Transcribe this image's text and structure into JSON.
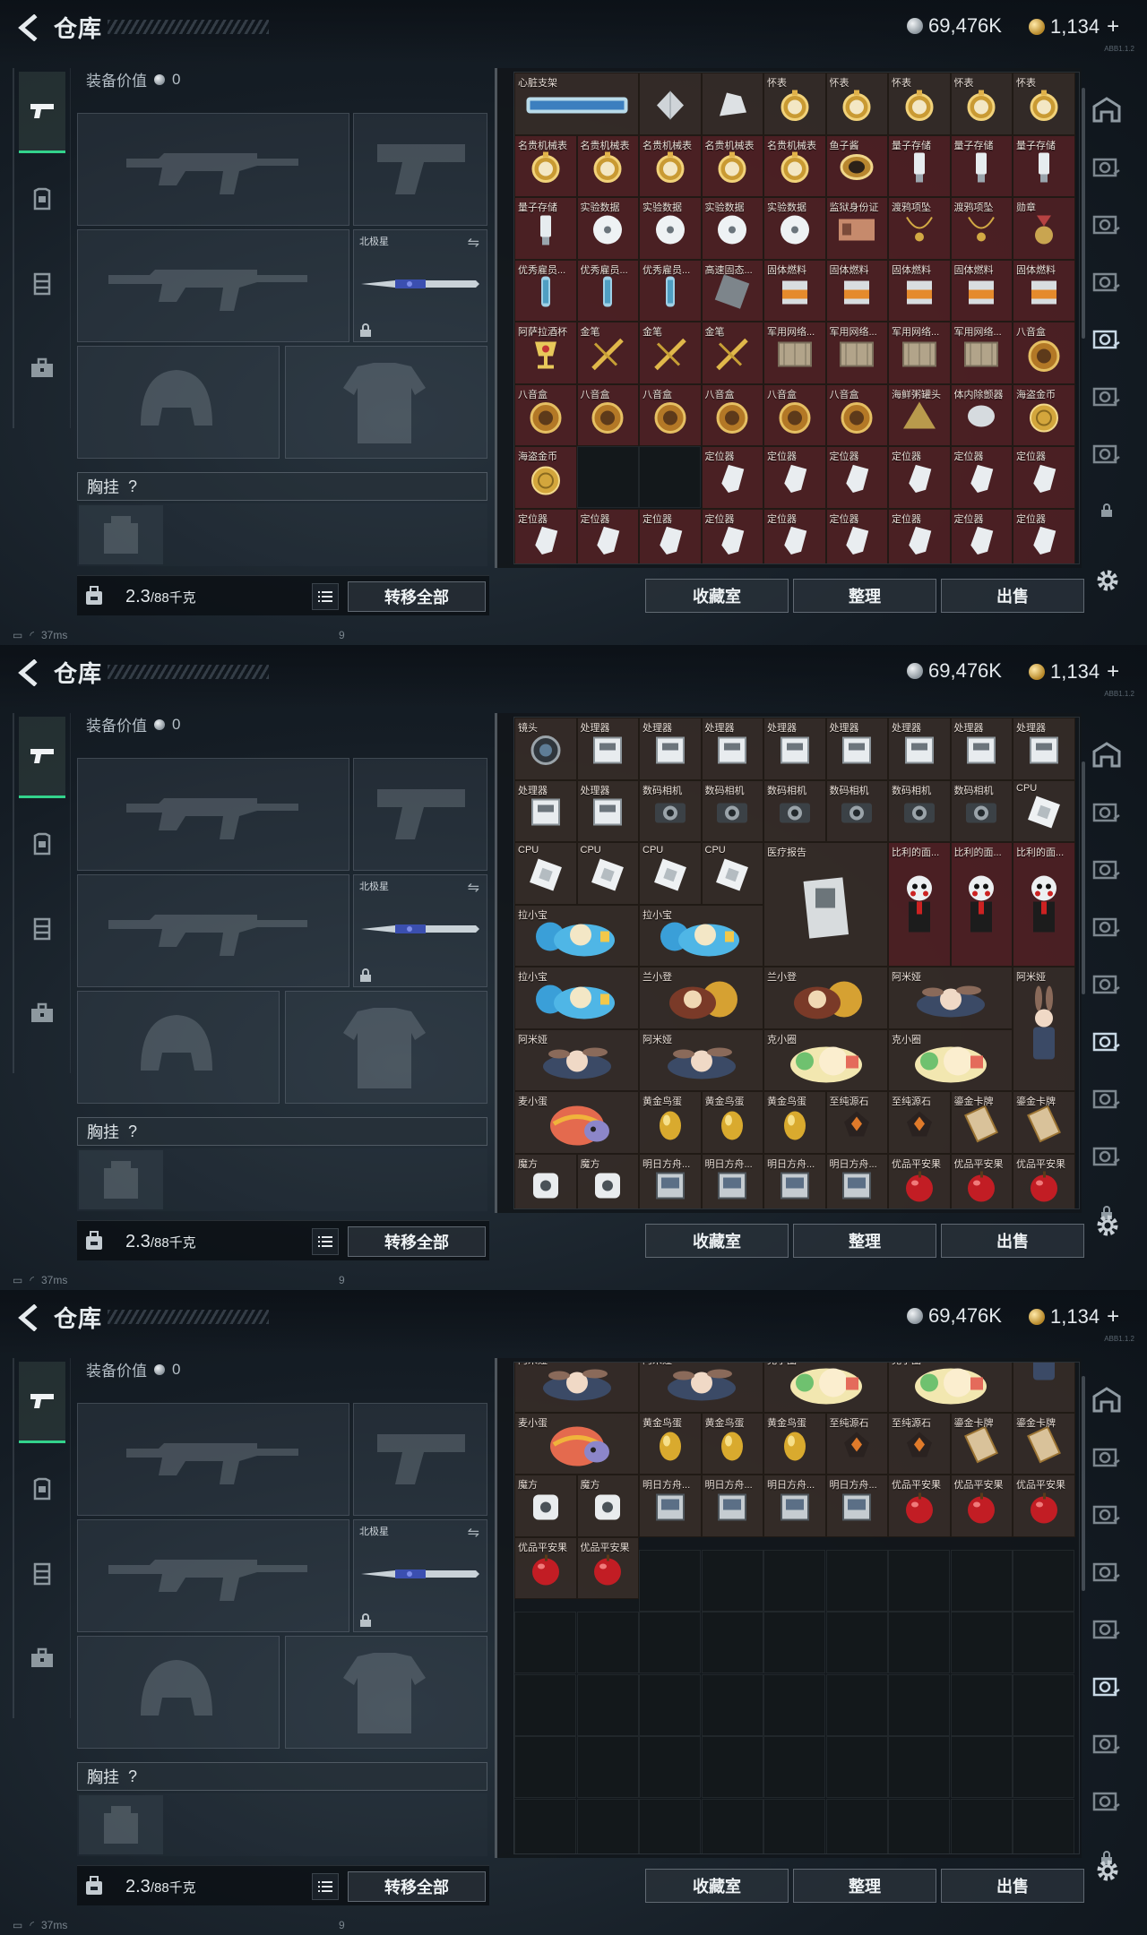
{
  "header": {
    "title": "仓库",
    "silver": "69,476K",
    "gold": "1,134",
    "plus": "+",
    "version": "ABB1.1.2"
  },
  "equipment": {
    "value_label": "装备价值",
    "value": "0",
    "melee_name": "北极星",
    "vest_label": "胸挂",
    "vest_help": "?",
    "weight_value": "2.3",
    "weight_unit": "/88千克",
    "transfer_all": "转移全部"
  },
  "buttons": {
    "collection": "收藏室",
    "arrange": "整理",
    "sell": "出售"
  },
  "status": {
    "ping": "37ms",
    "num": "9"
  },
  "screens": [
    {
      "items": [
        {
          "n": "心脏支架",
          "c": 0,
          "r": 0,
          "w": 2,
          "i": "stent"
        },
        {
          "n": "",
          "c": 2,
          "r": 0,
          "w": 1,
          "i": "crystal"
        },
        {
          "n": "",
          "c": 3,
          "r": 0,
          "w": 1,
          "i": "crystal2"
        },
        {
          "n": "怀表",
          "c": 4,
          "r": 0,
          "w": 1,
          "i": "watch"
        },
        {
          "n": "怀表",
          "c": 5,
          "r": 0,
          "w": 1,
          "i": "watch"
        },
        {
          "n": "怀表",
          "c": 6,
          "r": 0,
          "w": 1,
          "i": "watch"
        },
        {
          "n": "怀表",
          "c": 7,
          "r": 0,
          "w": 1,
          "i": "watch"
        },
        {
          "n": "怀表",
          "c": 8,
          "r": 0,
          "w": 1,
          "i": "watch"
        },
        {
          "n": "名贵机械表",
          "c": 0,
          "r": 1,
          "w": 1,
          "i": "gwatch"
        },
        {
          "n": "名贵机械表",
          "c": 1,
          "r": 1,
          "w": 1,
          "i": "gwatch"
        },
        {
          "n": "名贵机械表",
          "c": 2,
          "r": 1,
          "w": 1,
          "i": "gwatch"
        },
        {
          "n": "名贵机械表",
          "c": 3,
          "r": 1,
          "w": 1,
          "i": "gwatch"
        },
        {
          "n": "名贵机械表",
          "c": 4,
          "r": 1,
          "w": 1,
          "i": "gwatch"
        },
        {
          "n": "鱼子酱",
          "c": 5,
          "r": 1,
          "w": 1,
          "i": "caviar"
        },
        {
          "n": "量子存储",
          "c": 6,
          "r": 1,
          "w": 1,
          "i": "usb"
        },
        {
          "n": "量子存储",
          "c": 7,
          "r": 1,
          "w": 1,
          "i": "usb"
        },
        {
          "n": "量子存储",
          "c": 8,
          "r": 1,
          "w": 1,
          "i": "usb"
        },
        {
          "n": "量子存储",
          "c": 0,
          "r": 2,
          "w": 1,
          "i": "usb"
        },
        {
          "n": "实验数据",
          "c": 1,
          "r": 2,
          "w": 1,
          "i": "disc"
        },
        {
          "n": "实验数据",
          "c": 2,
          "r": 2,
          "w": 1,
          "i": "disc"
        },
        {
          "n": "实验数据",
          "c": 3,
          "r": 2,
          "w": 1,
          "i": "disc"
        },
        {
          "n": "实验数据",
          "c": 4,
          "r": 2,
          "w": 1,
          "i": "disc"
        },
        {
          "n": "监狱身份证",
          "c": 5,
          "r": 2,
          "w": 1,
          "i": "idcard"
        },
        {
          "n": "渡鸦项坠",
          "c": 6,
          "r": 2,
          "w": 1,
          "i": "pendant"
        },
        {
          "n": "渡鸦项坠",
          "c": 7,
          "r": 2,
          "w": 1,
          "i": "pendant"
        },
        {
          "n": "勋章",
          "c": 8,
          "r": 2,
          "w": 1,
          "i": "medal"
        },
        {
          "n": "优秀雇员...",
          "c": 0,
          "r": 3,
          "w": 1,
          "i": "tube"
        },
        {
          "n": "优秀雇员...",
          "c": 1,
          "r": 3,
          "w": 1,
          "i": "tube"
        },
        {
          "n": "优秀雇员...",
          "c": 2,
          "r": 3,
          "w": 1,
          "i": "tube"
        },
        {
          "n": "高速固态...",
          "c": 3,
          "r": 3,
          "w": 1,
          "i": "ssd"
        },
        {
          "n": "固体燃料",
          "c": 4,
          "r": 3,
          "w": 1,
          "i": "fuel"
        },
        {
          "n": "固体燃料",
          "c": 5,
          "r": 3,
          "w": 1,
          "i": "fuel"
        },
        {
          "n": "固体燃料",
          "c": 6,
          "r": 3,
          "w": 1,
          "i": "fuel"
        },
        {
          "n": "固体燃料",
          "c": 7,
          "r": 3,
          "w": 1,
          "i": "fuel"
        },
        {
          "n": "固体燃料",
          "c": 8,
          "r": 3,
          "w": 1,
          "i": "fuel"
        },
        {
          "n": "阿萨拉酒杯",
          "c": 0,
          "r": 4,
          "w": 1,
          "i": "goblet"
        },
        {
          "n": "金笔",
          "c": 1,
          "r": 4,
          "w": 1,
          "i": "pen"
        },
        {
          "n": "金笔",
          "c": 2,
          "r": 4,
          "w": 1,
          "i": "pen"
        },
        {
          "n": "金笔",
          "c": 3,
          "r": 4,
          "w": 1,
          "i": "pen"
        },
        {
          "n": "军用网络...",
          "c": 4,
          "r": 4,
          "w": 1,
          "i": "chip"
        },
        {
          "n": "军用网络...",
          "c": 5,
          "r": 4,
          "w": 1,
          "i": "chip"
        },
        {
          "n": "军用网络...",
          "c": 6,
          "r": 4,
          "w": 1,
          "i": "chip"
        },
        {
          "n": "军用网络...",
          "c": 7,
          "r": 4,
          "w": 1,
          "i": "chip"
        },
        {
          "n": "八音盒",
          "c": 8,
          "r": 4,
          "w": 1,
          "i": "musicbox"
        },
        {
          "n": "八音盒",
          "c": 0,
          "r": 5,
          "w": 1,
          "i": "musicbox"
        },
        {
          "n": "八音盒",
          "c": 1,
          "r": 5,
          "w": 1,
          "i": "musicbox"
        },
        {
          "n": "八音盒",
          "c": 2,
          "r": 5,
          "w": 1,
          "i": "musicbox"
        },
        {
          "n": "八音盒",
          "c": 3,
          "r": 5,
          "w": 1,
          "i": "musicbox"
        },
        {
          "n": "八音盒",
          "c": 4,
          "r": 5,
          "w": 1,
          "i": "musicbox"
        },
        {
          "n": "八音盒",
          "c": 5,
          "r": 5,
          "w": 1,
          "i": "musicbox"
        },
        {
          "n": "海鲜粥罐头",
          "c": 6,
          "r": 5,
          "w": 1,
          "i": "pyramid"
        },
        {
          "n": "体内除颤器",
          "c": 7,
          "r": 5,
          "w": 1,
          "i": "device"
        },
        {
          "n": "海盗金币",
          "c": 8,
          "r": 5,
          "w": 1,
          "i": "coin"
        },
        {
          "n": "海盗金币",
          "c": 0,
          "r": 6,
          "w": 1,
          "i": "coin"
        },
        {
          "n": "定位器",
          "c": 3,
          "r": 6,
          "w": 1,
          "i": "tracker"
        },
        {
          "n": "定位器",
          "c": 4,
          "r": 6,
          "w": 1,
          "i": "tracker"
        },
        {
          "n": "定位器",
          "c": 5,
          "r": 6,
          "w": 1,
          "i": "tracker"
        },
        {
          "n": "定位器",
          "c": 6,
          "r": 6,
          "w": 1,
          "i": "tracker"
        },
        {
          "n": "定位器",
          "c": 7,
          "r": 6,
          "w": 1,
          "i": "tracker"
        },
        {
          "n": "定位器",
          "c": 8,
          "r": 6,
          "w": 1,
          "i": "tracker"
        },
        {
          "n": "定位器",
          "c": 0,
          "r": 7,
          "w": 1,
          "i": "tracker"
        },
        {
          "n": "定位器",
          "c": 1,
          "r": 7,
          "w": 1,
          "i": "tracker"
        },
        {
          "n": "定位器",
          "c": 2,
          "r": 7,
          "w": 1,
          "i": "tracker"
        },
        {
          "n": "定位器",
          "c": 3,
          "r": 7,
          "w": 1,
          "i": "tracker"
        },
        {
          "n": "定位器",
          "c": 4,
          "r": 7,
          "w": 1,
          "i": "tracker"
        },
        {
          "n": "定位器",
          "c": 5,
          "r": 7,
          "w": 1,
          "i": "tracker"
        },
        {
          "n": "定位器",
          "c": 6,
          "r": 7,
          "w": 1,
          "i": "tracker"
        },
        {
          "n": "定位器",
          "c": 7,
          "r": 7,
          "w": 1,
          "i": "tracker"
        },
        {
          "n": "定位器",
          "c": 8,
          "r": 7,
          "w": 1,
          "i": "tracker"
        }
      ],
      "empty": [
        [
          1,
          6
        ],
        [
          2,
          6
        ]
      ],
      "red_rows": [
        1,
        2,
        3,
        4,
        5,
        6,
        7
      ],
      "rows": 8
    },
    {
      "items": [
        {
          "n": "镜头",
          "c": 0,
          "r": 0,
          "w": 1,
          "i": "lens"
        },
        {
          "n": "处理器",
          "c": 1,
          "r": 0,
          "w": 1,
          "i": "proc"
        },
        {
          "n": "处理器",
          "c": 2,
          "r": 0,
          "w": 1,
          "i": "proc"
        },
        {
          "n": "处理器",
          "c": 3,
          "r": 0,
          "w": 1,
          "i": "proc"
        },
        {
          "n": "处理器",
          "c": 4,
          "r": 0,
          "w": 1,
          "i": "proc"
        },
        {
          "n": "处理器",
          "c": 5,
          "r": 0,
          "w": 1,
          "i": "proc"
        },
        {
          "n": "处理器",
          "c": 6,
          "r": 0,
          "w": 1,
          "i": "proc"
        },
        {
          "n": "处理器",
          "c": 7,
          "r": 0,
          "w": 1,
          "i": "proc"
        },
        {
          "n": "处理器",
          "c": 8,
          "r": 0,
          "w": 1,
          "i": "proc"
        },
        {
          "n": "处理器",
          "c": 0,
          "r": 1,
          "w": 1,
          "i": "proc"
        },
        {
          "n": "处理器",
          "c": 1,
          "r": 1,
          "w": 1,
          "i": "proc"
        },
        {
          "n": "数码相机",
          "c": 2,
          "r": 1,
          "w": 1,
          "i": "camera"
        },
        {
          "n": "数码相机",
          "c": 3,
          "r": 1,
          "w": 1,
          "i": "camera"
        },
        {
          "n": "数码相机",
          "c": 4,
          "r": 1,
          "w": 1,
          "i": "camera"
        },
        {
          "n": "数码相机",
          "c": 5,
          "r": 1,
          "w": 1,
          "i": "camera"
        },
        {
          "n": "数码相机",
          "c": 6,
          "r": 1,
          "w": 1,
          "i": "camera"
        },
        {
          "n": "数码相机",
          "c": 7,
          "r": 1,
          "w": 1,
          "i": "camera"
        },
        {
          "n": "CPU",
          "c": 8,
          "r": 1,
          "w": 1,
          "i": "cpu"
        },
        {
          "n": "CPU",
          "c": 0,
          "r": 2,
          "w": 1,
          "i": "cpu"
        },
        {
          "n": "CPU",
          "c": 1,
          "r": 2,
          "w": 1,
          "i": "cpu"
        },
        {
          "n": "CPU",
          "c": 2,
          "r": 2,
          "w": 1,
          "i": "cpu"
        },
        {
          "n": "CPU",
          "c": 3,
          "r": 2,
          "w": 1,
          "i": "cpu"
        },
        {
          "n": "医疗报告",
          "c": 4,
          "r": 2,
          "w": 2,
          "h": 2,
          "i": "report"
        },
        {
          "n": "比利的面...",
          "c": 6,
          "r": 2,
          "w": 1,
          "h": 2,
          "i": "doll",
          "red": true
        },
        {
          "n": "比利的面...",
          "c": 7,
          "r": 2,
          "w": 1,
          "h": 2,
          "i": "doll",
          "red": true
        },
        {
          "n": "比利的面...",
          "c": 8,
          "r": 2,
          "w": 1,
          "h": 2,
          "i": "doll",
          "red": true
        },
        {
          "n": "拉小宝",
          "c": 0,
          "r": 3,
          "w": 2,
          "i": "figure_blue"
        },
        {
          "n": "拉小宝",
          "c": 2,
          "r": 3,
          "w": 2,
          "i": "figure_blue"
        },
        {
          "n": "拉小宝",
          "c": 0,
          "r": 4,
          "w": 2,
          "i": "figure_blue"
        },
        {
          "n": "兰小登",
          "c": 2,
          "r": 4,
          "w": 2,
          "i": "figure_gold"
        },
        {
          "n": "兰小登",
          "c": 4,
          "r": 4,
          "w": 2,
          "i": "figure_gold"
        },
        {
          "n": "阿米娅",
          "c": 6,
          "r": 4,
          "w": 2,
          "i": "bunny"
        },
        {
          "n": "阿米娅",
          "c": 8,
          "r": 4,
          "w": 1,
          "h": 2,
          "i": "bunny_tall"
        },
        {
          "n": "阿米娅",
          "c": 0,
          "r": 5,
          "w": 2,
          "i": "bunny"
        },
        {
          "n": "阿米娅",
          "c": 2,
          "r": 5,
          "w": 2,
          "i": "bunny"
        },
        {
          "n": "克小圈",
          "c": 4,
          "r": 5,
          "w": 2,
          "i": "figure_green"
        },
        {
          "n": "克小圈",
          "c": 6,
          "r": 5,
          "w": 2,
          "i": "figure_green"
        },
        {
          "n": "麦小蛋",
          "c": 0,
          "r": 6,
          "w": 2,
          "i": "egg_toy"
        },
        {
          "n": "黄金鸟蛋",
          "c": 2,
          "r": 6,
          "w": 1,
          "i": "gold_egg"
        },
        {
          "n": "黄金鸟蛋",
          "c": 3,
          "r": 6,
          "w": 1,
          "i": "gold_egg"
        },
        {
          "n": "黄金鸟蛋",
          "c": 4,
          "r": 6,
          "w": 1,
          "i": "gold_egg"
        },
        {
          "n": "至纯源石",
          "c": 5,
          "r": 6,
          "w": 1,
          "i": "orestone"
        },
        {
          "n": "至纯源石",
          "c": 6,
          "r": 6,
          "w": 1,
          "i": "orestone"
        },
        {
          "n": "鎏金卡牌",
          "c": 7,
          "r": 6,
          "w": 1,
          "i": "card"
        },
        {
          "n": "鎏金卡牌",
          "c": 8,
          "r": 6,
          "w": 1,
          "i": "card"
        },
        {
          "n": "魔方",
          "c": 0,
          "r": 7,
          "w": 1,
          "i": "cube"
        },
        {
          "n": "魔方",
          "c": 1,
          "r": 7,
          "w": 1,
          "i": "cube"
        },
        {
          "n": "明日方舟...",
          "c": 2,
          "r": 7,
          "w": 1,
          "i": "ticket"
        },
        {
          "n": "明日方舟...",
          "c": 3,
          "r": 7,
          "w": 1,
          "i": "ticket"
        },
        {
          "n": "明日方舟...",
          "c": 4,
          "r": 7,
          "w": 1,
          "i": "ticket"
        },
        {
          "n": "明日方舟...",
          "c": 5,
          "r": 7,
          "w": 1,
          "i": "ticket"
        },
        {
          "n": "优品平安果",
          "c": 6,
          "r": 7,
          "w": 1,
          "i": "apple"
        },
        {
          "n": "优品平安果",
          "c": 7,
          "r": 7,
          "w": 1,
          "i": "apple"
        },
        {
          "n": "优品平安果",
          "c": 8,
          "r": 7,
          "w": 1,
          "i": "apple"
        }
      ],
      "empty": [],
      "red_rows": [],
      "rows": 8
    },
    {
      "items": [
        {
          "n": "",
          "c": 0,
          "r": -1,
          "w": 2,
          "i": "figure_green"
        },
        {
          "n": "",
          "c": 2,
          "r": -1,
          "w": 2,
          "i": "figure_gold"
        },
        {
          "n": "",
          "c": 6,
          "r": -1,
          "w": 2,
          "i": "bunny"
        },
        {
          "n": "阿米娅",
          "c": 0,
          "r": 0,
          "w": 2,
          "i": "bunny"
        },
        {
          "n": "阿米娅",
          "c": 2,
          "r": 0,
          "w": 2,
          "i": "bunny"
        },
        {
          "n": "克小圈",
          "c": 4,
          "r": 0,
          "w": 2,
          "i": "figure_green"
        },
        {
          "n": "克小圈",
          "c": 6,
          "r": 0,
          "w": 2,
          "i": "figure_green"
        },
        {
          "n": "",
          "c": 8,
          "r": -1,
          "w": 1,
          "h": 2,
          "i": "bunny_tall"
        },
        {
          "n": "麦小蛋",
          "c": 0,
          "r": 1,
          "w": 2,
          "i": "egg_toy"
        },
        {
          "n": "黄金鸟蛋",
          "c": 2,
          "r": 1,
          "w": 1,
          "i": "gold_egg"
        },
        {
          "n": "黄金鸟蛋",
          "c": 3,
          "r": 1,
          "w": 1,
          "i": "gold_egg"
        },
        {
          "n": "黄金鸟蛋",
          "c": 4,
          "r": 1,
          "w": 1,
          "i": "gold_egg"
        },
        {
          "n": "至纯源石",
          "c": 5,
          "r": 1,
          "w": 1,
          "i": "orestone"
        },
        {
          "n": "至纯源石",
          "c": 6,
          "r": 1,
          "w": 1,
          "i": "orestone"
        },
        {
          "n": "鎏金卡牌",
          "c": 7,
          "r": 1,
          "w": 1,
          "i": "card"
        },
        {
          "n": "鎏金卡牌",
          "c": 8,
          "r": 1,
          "w": 1,
          "i": "card"
        },
        {
          "n": "魔方",
          "c": 0,
          "r": 2,
          "w": 1,
          "i": "cube"
        },
        {
          "n": "魔方",
          "c": 1,
          "r": 2,
          "w": 1,
          "i": "cube"
        },
        {
          "n": "明日方舟...",
          "c": 2,
          "r": 2,
          "w": 1,
          "i": "ticket"
        },
        {
          "n": "明日方舟...",
          "c": 3,
          "r": 2,
          "w": 1,
          "i": "ticket"
        },
        {
          "n": "明日方舟...",
          "c": 4,
          "r": 2,
          "w": 1,
          "i": "ticket"
        },
        {
          "n": "明日方舟...",
          "c": 5,
          "r": 2,
          "w": 1,
          "i": "ticket"
        },
        {
          "n": "优品平安果",
          "c": 6,
          "r": 2,
          "w": 1,
          "i": "apple"
        },
        {
          "n": "优品平安果",
          "c": 7,
          "r": 2,
          "w": 1,
          "i": "apple"
        },
        {
          "n": "优品平安果",
          "c": 8,
          "r": 2,
          "w": 1,
          "i": "apple"
        },
        {
          "n": "优品平安果",
          "c": 0,
          "r": 3,
          "w": 1,
          "i": "apple"
        },
        {
          "n": "优品平安果",
          "c": 1,
          "r": 3,
          "w": 1,
          "i": "apple"
        }
      ],
      "empty_from": [
        3,
        2
      ],
      "empty": [],
      "red_rows": [],
      "rows": 8
    }
  ]
}
